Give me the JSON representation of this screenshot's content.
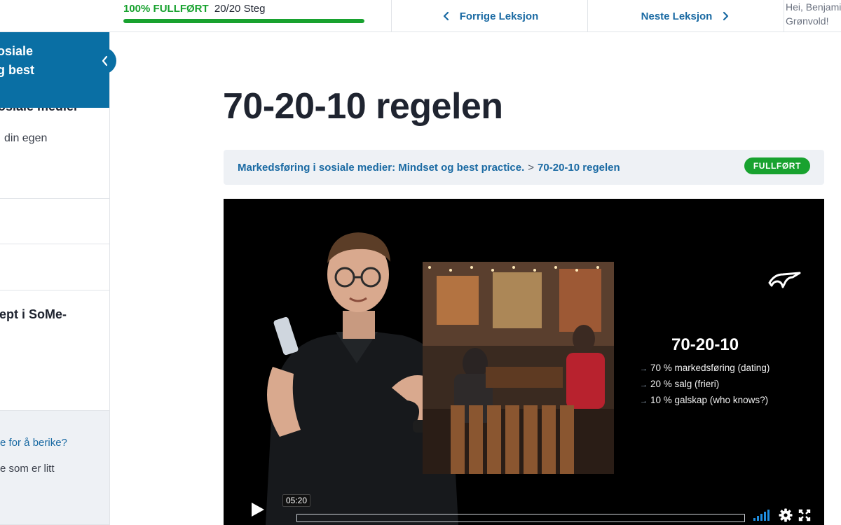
{
  "topbar": {
    "progress_percent_label": "100% FULLFØRT",
    "progress_steps_label": "20/20 Steg",
    "progress_fraction": 1.0,
    "prev_label": "Forrige Leksjon",
    "next_label": "Neste Leksjon",
    "greeting": "Hei, Benjamin",
    "greeting_name": "Grønvold!"
  },
  "sidebar": {
    "course_title_line1": "osiale",
    "course_title_line2": "g best",
    "items": [
      {
        "text": "osiale medier"
      },
      {
        "text": "din egen"
      },
      {
        "text": "ept i SoMe-"
      },
      {
        "text": "e for å berike?"
      },
      {
        "text": "e som er litt"
      }
    ]
  },
  "lesson": {
    "title": "70-20-10 regelen",
    "breadcrumb_course": "Markedsføring i sosiale medier: Mindset og best practice.",
    "breadcrumb_separator": ">",
    "breadcrumb_lesson": "70-20-10 regelen",
    "status_badge": "FULLFØRT"
  },
  "video": {
    "slide_heading": "70-20-10",
    "bullets": [
      "70 % markedsføring (dating)",
      "20 % salg (frieri)",
      "10 % galskap (who knows?)"
    ],
    "time_tooltip": "05:20"
  },
  "colors": {
    "accent": "#0a6fa4",
    "link": "#1a6aa3",
    "success": "#18a22f"
  },
  "icons": {
    "prev": "chevron-left-icon",
    "next": "chevron-right-icon",
    "collapse": "chevron-left-icon",
    "play": "play-icon",
    "volume": "volume-icon",
    "settings": "gear-icon",
    "fullscreen": "fullscreen-icon"
  }
}
